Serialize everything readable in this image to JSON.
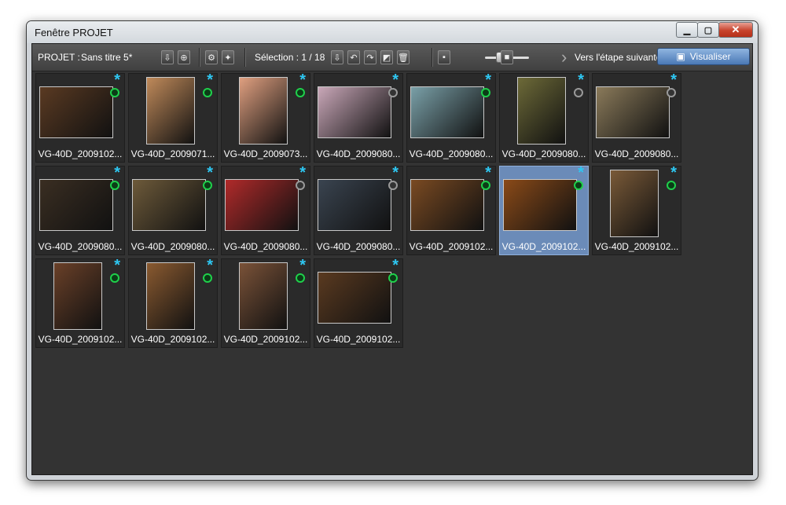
{
  "window": {
    "title": "Fenêtre PROJET",
    "minimize_glyph": "▁",
    "maximize_glyph": "▢",
    "close_glyph": "✕"
  },
  "toolbar": {
    "project_label": "PROJET :",
    "project_name": "Sans titre 5*",
    "selection_text": "Sélection : 1 / 18",
    "next_step_arrow": "›",
    "next_step_label": "Vers l'étape suivante",
    "visualiser_label": "Visualiser",
    "zoom_level": 0.3
  },
  "colors": {
    "star": "#2ec7f2",
    "green_dot": "#1fd04b",
    "grey_dot": "#9a9a9a",
    "selection": "#6b8bb8"
  },
  "thumbnails": [
    {
      "caption": "VG-40D_2009102...",
      "status": "green",
      "tone": "#5a3a22"
    },
    {
      "caption": "VG-40D_2009071...",
      "status": "green",
      "tone": "#c08a5a"
    },
    {
      "caption": "VG-40D_2009073...",
      "status": "green",
      "tone": "#e0a080"
    },
    {
      "caption": "VG-40D_2009080...",
      "status": "grey",
      "tone": "#c9a7b8"
    },
    {
      "caption": "VG-40D_2009080...",
      "status": "green",
      "tone": "#7aa0a8"
    },
    {
      "caption": "VG-40D_2009080...",
      "status": "grey",
      "tone": "#6d6a38"
    },
    {
      "caption": "VG-40D_2009080...",
      "status": "grey",
      "tone": "#8a7a5a"
    },
    {
      "caption": "VG-40D_2009080...",
      "status": "green",
      "tone": "#3a2e22"
    },
    {
      "caption": "VG-40D_2009080...",
      "status": "green",
      "tone": "#6d5a3a"
    },
    {
      "caption": "VG-40D_2009080...",
      "status": "grey",
      "tone": "#b02a2a"
    },
    {
      "caption": "VG-40D_2009080...",
      "status": "grey",
      "tone": "#3a4450"
    },
    {
      "caption": "VG-40D_2009102...",
      "status": "green",
      "tone": "#7a4a22"
    },
    {
      "caption": "VG-40D_2009102...",
      "status": "green",
      "tone": "#8a4a18",
      "selected": true
    },
    {
      "caption": "VG-40D_2009102...",
      "status": "green",
      "tone": "#7a5a38"
    },
    {
      "caption": "VG-40D_2009102...",
      "status": "green",
      "tone": "#6a4028"
    },
    {
      "caption": "VG-40D_2009102...",
      "status": "green",
      "tone": "#8a5a30"
    },
    {
      "caption": "VG-40D_2009102...",
      "status": "green",
      "tone": "#7a5238"
    },
    {
      "caption": "VG-40D_2009102...",
      "status": "green",
      "tone": "#5a3a20"
    }
  ]
}
